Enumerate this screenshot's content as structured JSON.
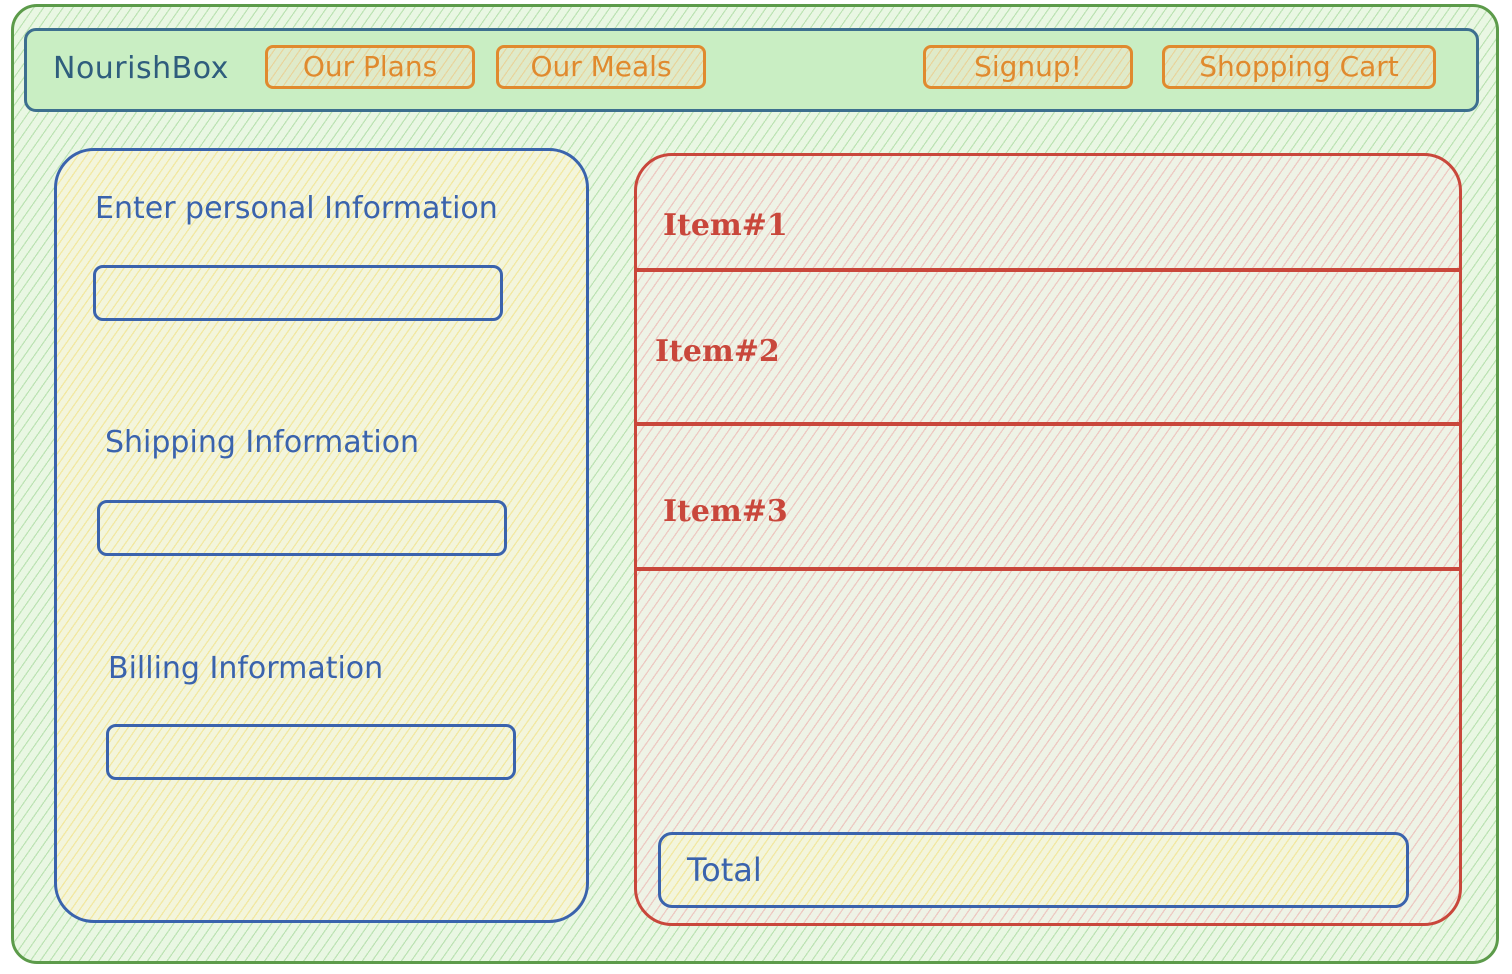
{
  "navbar": {
    "brand": "NourishBox",
    "plans_label": "Our Plans",
    "meals_label": "Our Meals",
    "signup_label": "Signup!",
    "cart_label": "Shopping Cart"
  },
  "form": {
    "personal_label": "Enter personal Information",
    "personal_value": "",
    "shipping_label": "Shipping Information",
    "shipping_value": "",
    "billing_label": "Billing Information",
    "billing_value": ""
  },
  "cart": {
    "items": [
      {
        "label": "Item#1"
      },
      {
        "label": "Item#2"
      },
      {
        "label": "Item#3"
      }
    ],
    "total_label": "Total"
  },
  "colors": {
    "frame": "#5c9b4a",
    "navbar_bg": "#c9eec3",
    "navbar_border": "#3d6f8f",
    "nav_button": "#e08a2e",
    "form_accent": "#3a63ad",
    "cart_accent": "#c9473b"
  }
}
